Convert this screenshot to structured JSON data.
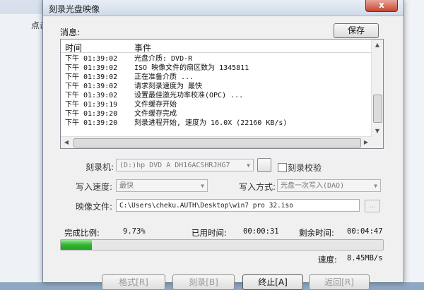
{
  "background": {
    "left_text": "点击"
  },
  "window": {
    "title": "刻录光盘映像",
    "close_label": "x"
  },
  "messages": {
    "label": "消息:",
    "save_label": "保存",
    "columns": [
      "时间",
      "事件"
    ],
    "rows": [
      {
        "time": "下午 01:39:02",
        "event": "光盘介质: DVD-R"
      },
      {
        "time": "下午 01:39:02",
        "event": "ISO 映像文件的扇区数为 1345811"
      },
      {
        "time": "下午 01:39:02",
        "event": "正在准备介质 ..."
      },
      {
        "time": "下午 01:39:02",
        "event": "请求刻录速度为 最快"
      },
      {
        "time": "下午 01:39:02",
        "event": "设置最佳激光功率校准(OPC) ..."
      },
      {
        "time": "下午 01:39:19",
        "event": "文件缓存开始"
      },
      {
        "time": "下午 01:39:20",
        "event": "文件缓存完成"
      },
      {
        "time": "下午 01:39:20",
        "event": "刻录进程开始, 速度为 16.0X (22160 KB/s)"
      }
    ]
  },
  "settings": {
    "burner_label": "刻录机:",
    "burner_value": "(D:)hp      DVD A  DH16ACSHRJHG7",
    "verify_label": "刻录校验",
    "speed_label": "写入速度:",
    "speed_value": "最快",
    "mode_label": "写入方式:",
    "mode_value": "光盘一次写入(DAO)",
    "image_label": "映像文件:",
    "image_value": "C:\\Users\\cheku.AUTH\\Desktop\\win7 pro 32.iso",
    "browse_label": "..."
  },
  "progress": {
    "complete_label": "完成比例:",
    "complete_value": "9.73%",
    "fraction": 0.0973,
    "elapsed_label": "已用时间:",
    "elapsed_value": "00:00:31",
    "remaining_label": "剩余时间:",
    "remaining_value": "00:04:47",
    "speed_label": "速度:",
    "speed_value": "8.45MB/s"
  },
  "buttons": {
    "b1": "格式[R]",
    "b2": "刻录[B]",
    "b3": "终止[A]",
    "b4": "返回[R]"
  },
  "colors": {
    "progress": "#2fb52f",
    "close": "#c8462f"
  }
}
